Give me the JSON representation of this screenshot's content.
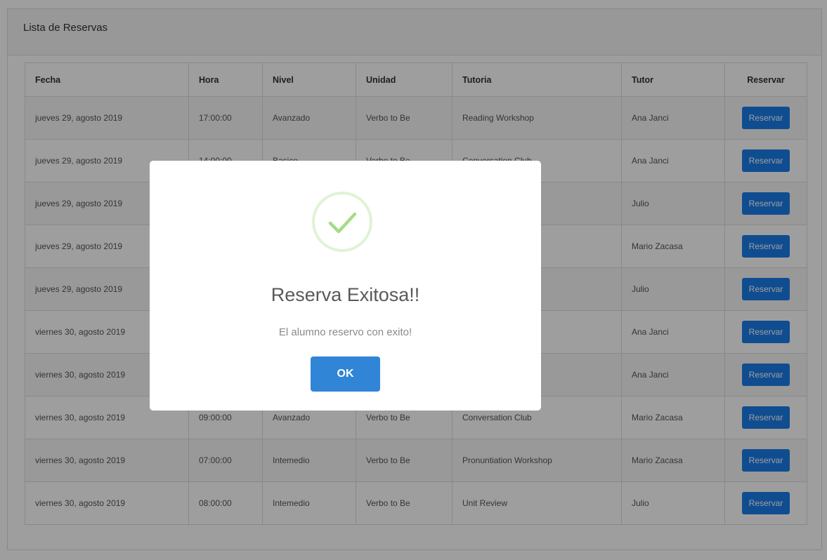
{
  "panel": {
    "title": "Lista de Reservas"
  },
  "table": {
    "headers": [
      "Fecha",
      "Hora",
      "Nivel",
      "Unidad",
      "Tutoria",
      "Tutor",
      "Reservar"
    ],
    "button_label": "Reservar",
    "rows": [
      [
        "jueves 29, agosto 2019",
        "17:00:00",
        "Avanzado",
        "Verbo to Be",
        "Reading Workshop",
        "Ana Janci"
      ],
      [
        "jueves 29, agosto 2019",
        "14:00:00",
        "Basico",
        "Verbo to Be",
        "Conversation Club",
        "Ana Janci"
      ],
      [
        "jueves 29, agosto 2019",
        "",
        "",
        "",
        "",
        "Julio"
      ],
      [
        "jueves 29, agosto 2019",
        "",
        "",
        "",
        "op",
        "Mario Zacasa"
      ],
      [
        "jueves 29, agosto 2019",
        "",
        "",
        "",
        "",
        "Julio"
      ],
      [
        "viernes 30, agosto 2019",
        "",
        "",
        "",
        "op",
        "Ana Janci"
      ],
      [
        "viernes 30, agosto 2019",
        "",
        "",
        "",
        "",
        "Ana Janci"
      ],
      [
        "viernes 30, agosto 2019",
        "09:00:00",
        "Avanzado",
        "Verbo to Be",
        "Conversation Club",
        "Mario Zacasa"
      ],
      [
        "viernes 30, agosto 2019",
        "07:00:00",
        "Intemedio",
        "Verbo to Be",
        "Pronuntiation Workshop",
        "Mario Zacasa"
      ],
      [
        "viernes 30, agosto 2019",
        "08:00:00",
        "Intemedio",
        "Verbo to Be",
        "Unit Review",
        "Julio"
      ]
    ]
  },
  "modal": {
    "icon": "success-check-icon",
    "title": "Reserva Exitosa!!",
    "text": "El alumno reservo con exito!",
    "ok_label": "OK"
  },
  "colors": {
    "button_primary": "#1a7ce8",
    "ok_button": "#3085d6",
    "success_check": "#a5dc86"
  }
}
